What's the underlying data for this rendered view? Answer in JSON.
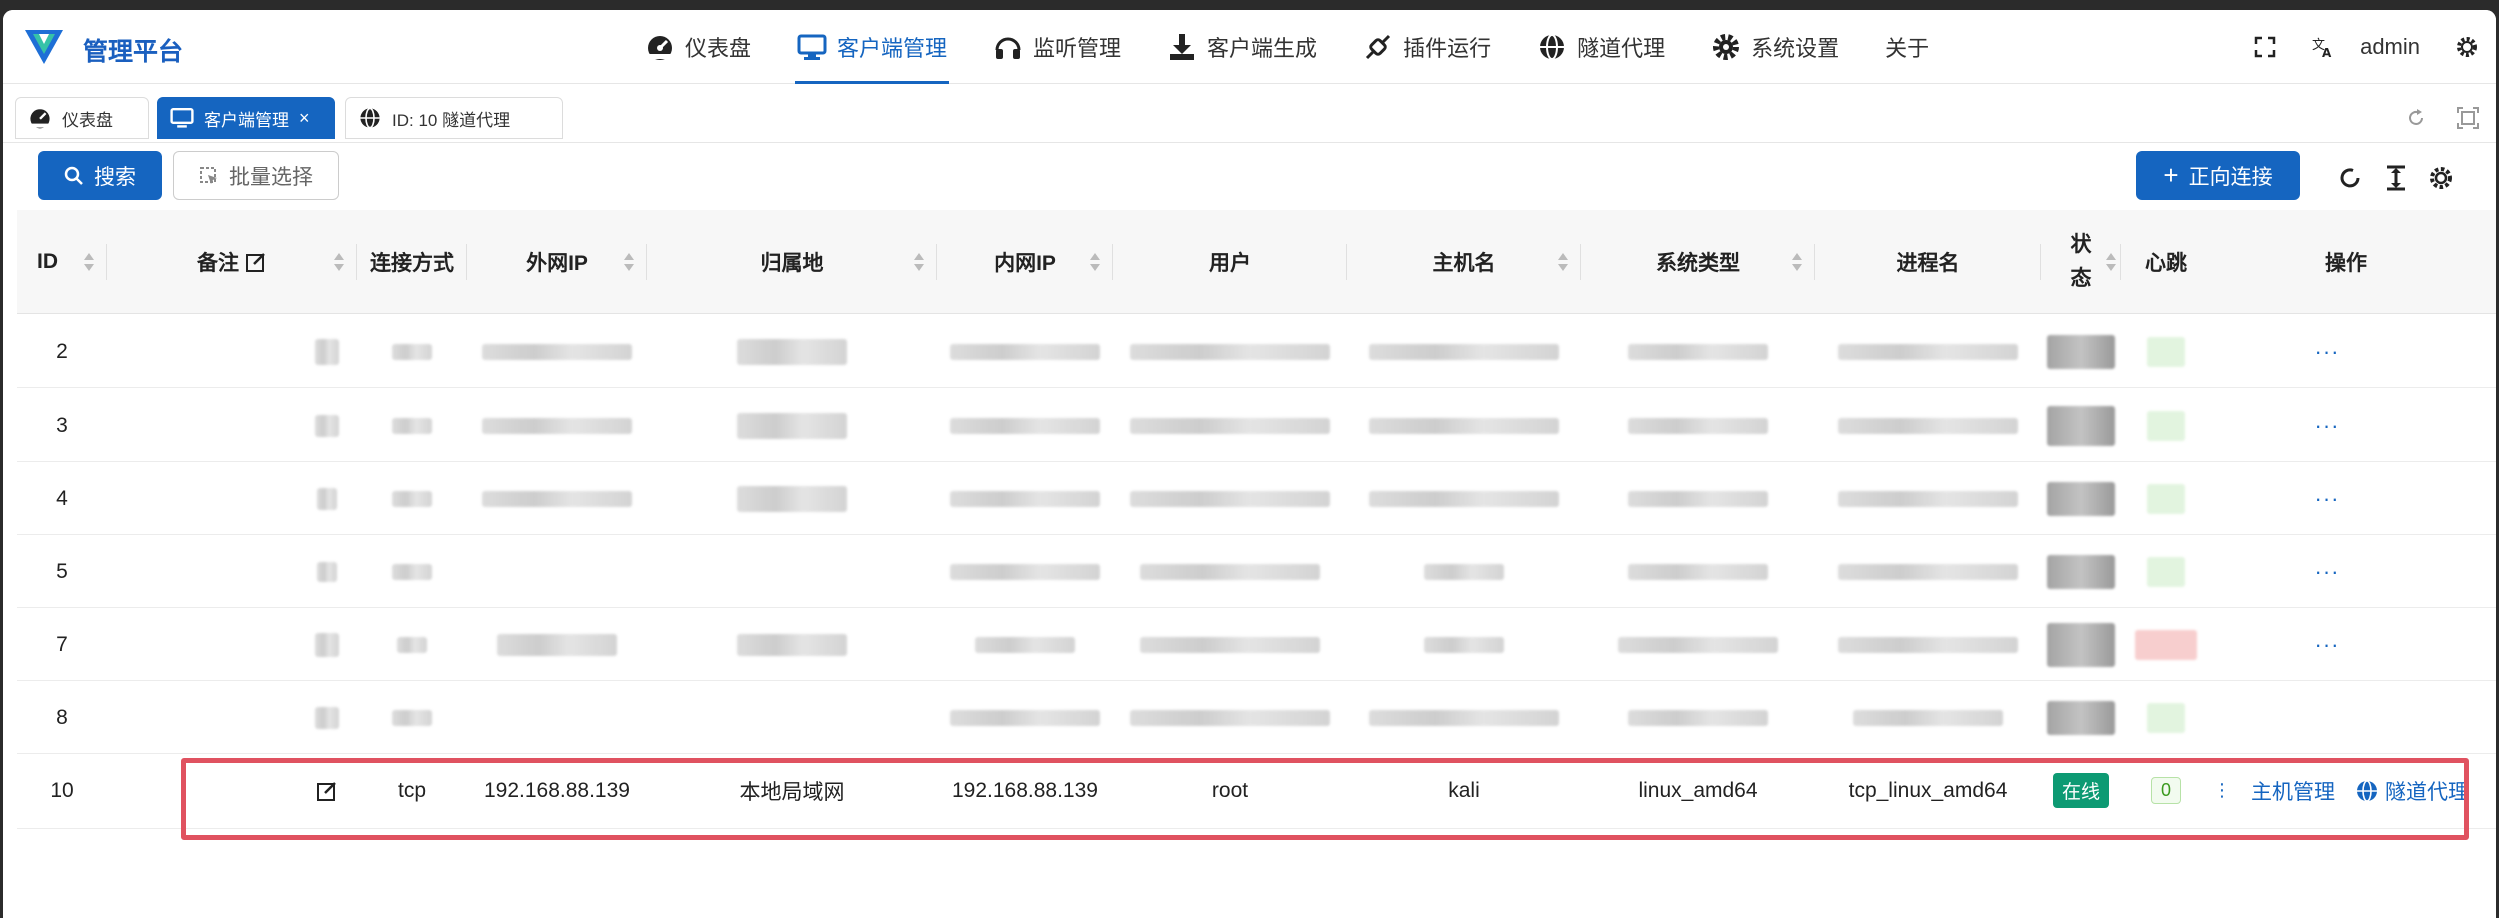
{
  "header": {
    "brand": "管理平台",
    "nav": [
      {
        "label": "仪表盘",
        "icon": "dashboard-icon"
      },
      {
        "label": "客户端管理",
        "icon": "monitor-icon",
        "active": true
      },
      {
        "label": "监听管理",
        "icon": "headphones-icon"
      },
      {
        "label": "客户端生成",
        "icon": "download-icon"
      },
      {
        "label": "插件运行",
        "icon": "plug-icon"
      },
      {
        "label": "隧道代理",
        "icon": "globe-icon"
      },
      {
        "label": "系统设置",
        "icon": "gear-icon"
      },
      {
        "label": "关于",
        "icon": ""
      }
    ],
    "user": "admin"
  },
  "tabs": [
    {
      "label": "仪表盘",
      "icon": "dashboard-icon"
    },
    {
      "label": "客户端管理",
      "icon": "monitor-icon",
      "active": true,
      "close": "×"
    },
    {
      "label": "ID: 10 隧道代理",
      "icon": "globe-icon"
    }
  ],
  "toolbar": {
    "search_label": "搜索",
    "batch_label": "批量选择",
    "connect_label": "正向连接"
  },
  "table": {
    "columns": [
      "ID",
      "备注",
      "连接方式",
      "外网IP",
      "归属地",
      "内网IP",
      "用户",
      "主机名",
      "系统类型",
      "进程名",
      "状",
      "态",
      "心跳",
      "操作"
    ],
    "rows_ids": [
      "2",
      "3",
      "4",
      "5",
      "7",
      "8",
      "10"
    ],
    "row10": {
      "id": "10",
      "conn": "tcp",
      "wan_ip": "192.168.88.139",
      "location": "本地局域网",
      "lan_ip": "192.168.88.139",
      "user": "root",
      "host": "kali",
      "os": "linux_amd64",
      "process": "tcp_linux_amd64",
      "status": "在线",
      "heartbeat": "0",
      "action_host": "主机管理",
      "action_tunnel": "隧道代理"
    },
    "more": "···"
  },
  "colors": {
    "primary": "#1565c0",
    "online": "#0d9a73",
    "highlight": "#e05260"
  }
}
